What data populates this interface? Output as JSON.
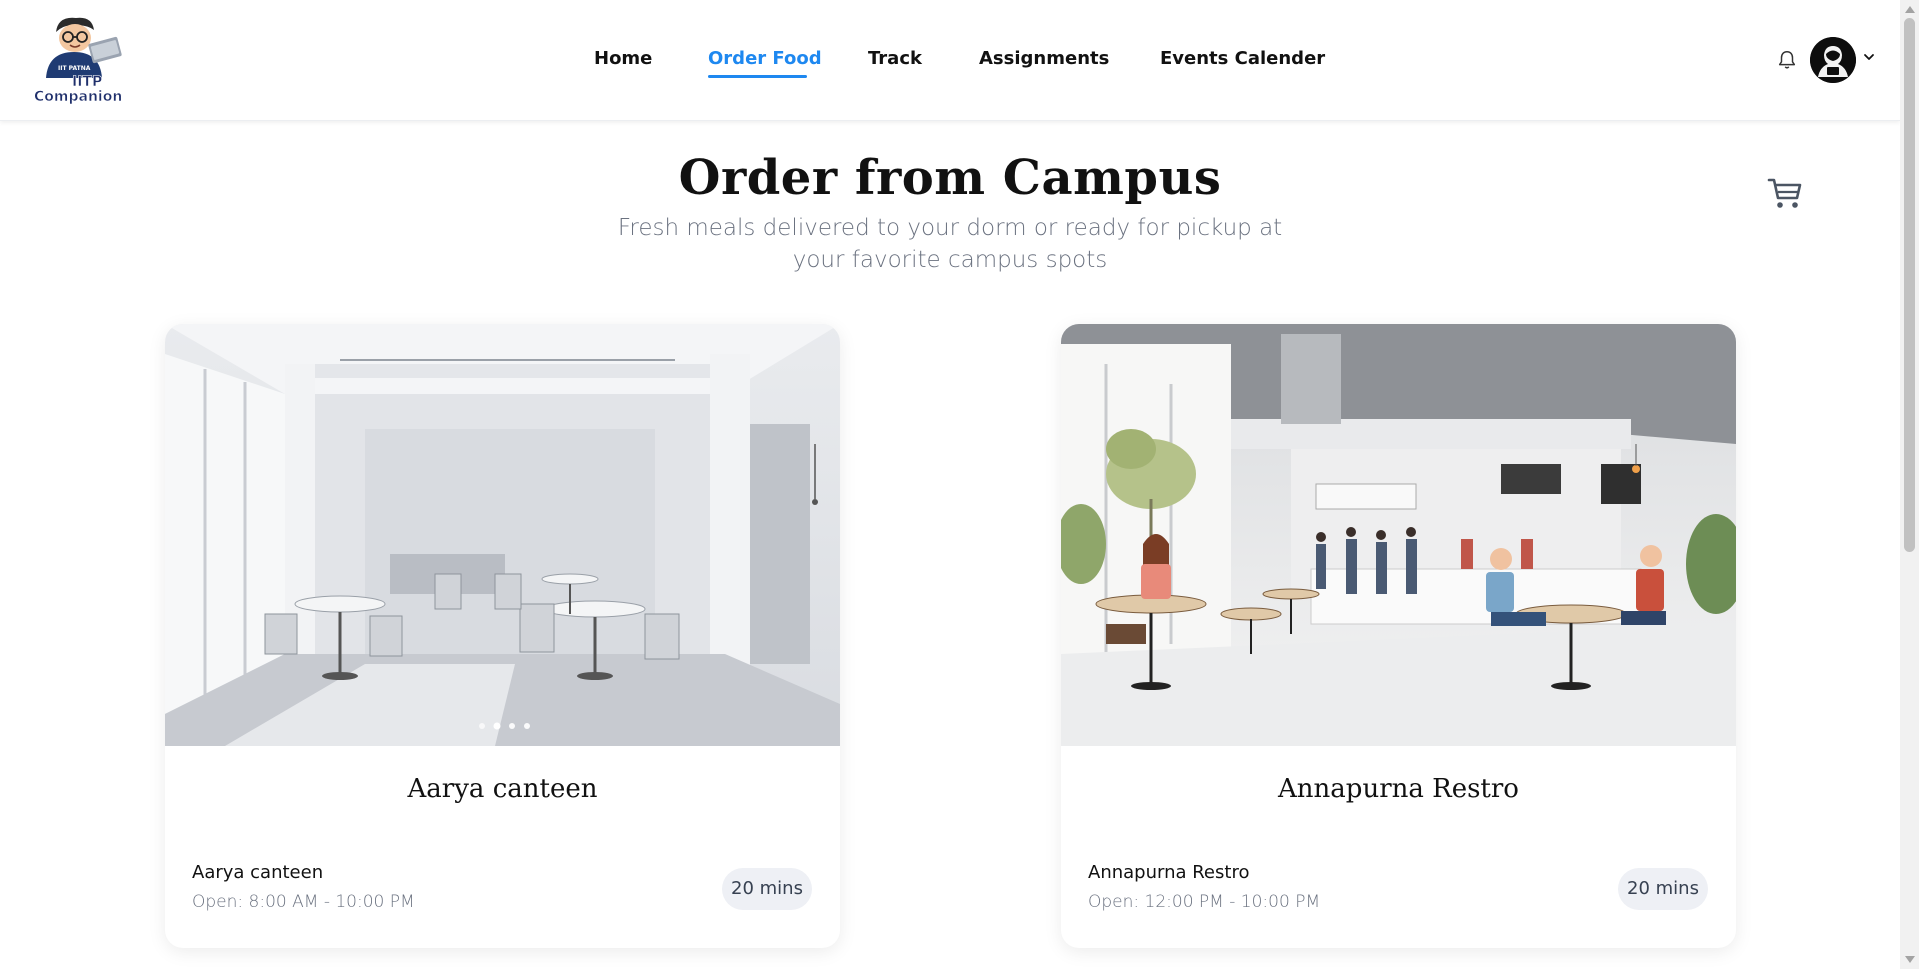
{
  "app": {
    "logo_text_line1": "IITP",
    "logo_text_line2": "Companion",
    "logo_text_tshirt": "IIT PATNA"
  },
  "nav": {
    "items": [
      {
        "label": "Home"
      },
      {
        "label": "Order Food",
        "active": true
      },
      {
        "label": "Track"
      },
      {
        "label": "Assignments"
      },
      {
        "label": "Events Calender"
      }
    ]
  },
  "header_icons": {
    "notifications": "bell-icon",
    "profile": "avatar",
    "profile_menu": "chevron-down-icon"
  },
  "hero": {
    "title": "Order from Campus",
    "subtitle": "Fresh meals delivered to your dorm or ready for pickup at your favorite campus spots",
    "cart_icon": "cart-icon"
  },
  "restaurants": [
    {
      "title": "Aarya canteen",
      "name": "Aarya canteen",
      "hours": "Open: 8:00 AM - 10:00 PM",
      "time": "20 mins",
      "carousel_slides": 4
    },
    {
      "title": "Annapurna Restro",
      "name": "Annapurna Restro",
      "hours": "Open: 12:00 PM - 10:00 PM",
      "time": "20 mins"
    }
  ],
  "colors": {
    "accent": "#1e88f0",
    "text_muted": "#6b7280",
    "badge_bg": "#eef0f5"
  }
}
